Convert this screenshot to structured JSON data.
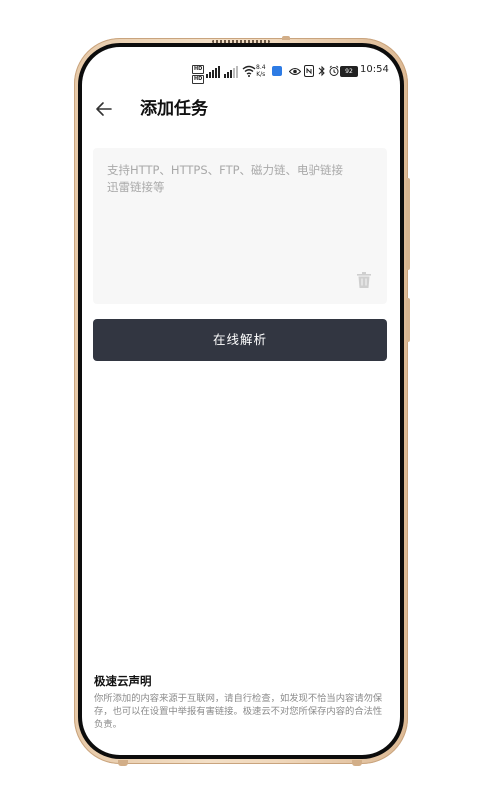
{
  "status_bar": {
    "hd_badge_top": "HD",
    "hd_badge_bottom": "HD",
    "net_speed_value": "8.4",
    "net_speed_unit": "K/s",
    "battery_level": "92",
    "time": "10:54"
  },
  "header": {
    "back_icon": "arrow-left-icon",
    "title": "添加任务"
  },
  "link_input": {
    "placeholder": "支持HTTP、HTTPS、FTP、磁力链、电驴链接\n迅雷链接等",
    "value": "",
    "clear_icon": "trash-icon"
  },
  "parse_button": {
    "label": "在线解析",
    "background": "#323641"
  },
  "disclaimer": {
    "title": "极速云声明",
    "body": "你所添加的内容来源于互联网，请自行检查，如发现不恰当内容请勿保存，也可以在设置中举报有害链接。极速云不对您所保存内容的合法性负责。"
  }
}
